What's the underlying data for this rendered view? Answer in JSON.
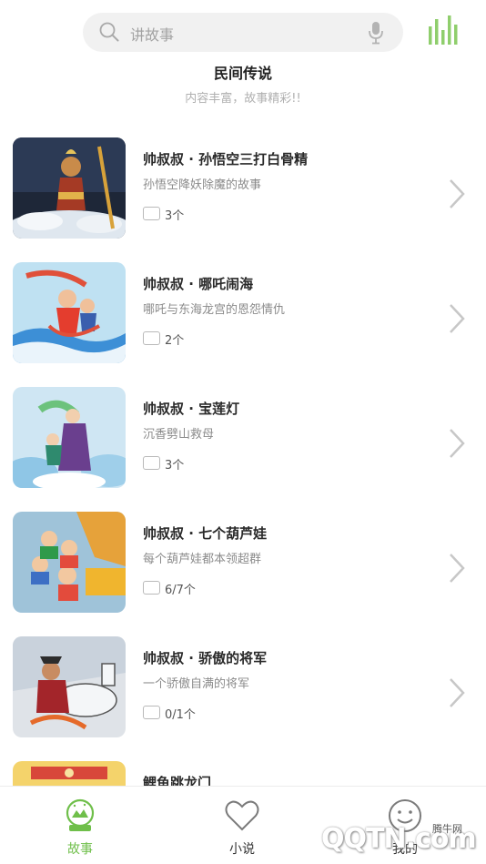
{
  "search": {
    "placeholder": "讲故事"
  },
  "header": {
    "title": "民间传说",
    "subtitle": "内容丰富，故事精彩!!"
  },
  "stories": [
    {
      "title": "帅叔叔 · 孙悟空三打白骨精",
      "desc": "孙悟空降妖除魔的故事",
      "count": "3个"
    },
    {
      "title": "帅叔叔 · 哪吒闹海",
      "desc": "哪吒与东海龙宫的恩怨情仇",
      "count": "2个"
    },
    {
      "title": "帅叔叔 · 宝莲灯",
      "desc": "沉香劈山救母",
      "count": "3个"
    },
    {
      "title": "帅叔叔 · 七个葫芦娃",
      "desc": "每个葫芦娃都本领超群",
      "count": "6/7个"
    },
    {
      "title": "帅叔叔 · 骄傲的将军",
      "desc": "一个骄傲自满的将军",
      "count": "0/1个"
    },
    {
      "title": "鲤鱼跳龙门"
    }
  ],
  "tabs": [
    {
      "label": "故事",
      "icon": "snow-globe-icon",
      "active": true
    },
    {
      "label": "小说",
      "icon": "heart-icon",
      "active": false
    },
    {
      "label": "我的",
      "icon": "smiley-icon",
      "active": false
    }
  ],
  "watermark": {
    "main": "QQTN.com",
    "small": "腾牛网"
  },
  "colors": {
    "accent": "#6fbf4a",
    "search_bg": "#f1f1f1"
  }
}
